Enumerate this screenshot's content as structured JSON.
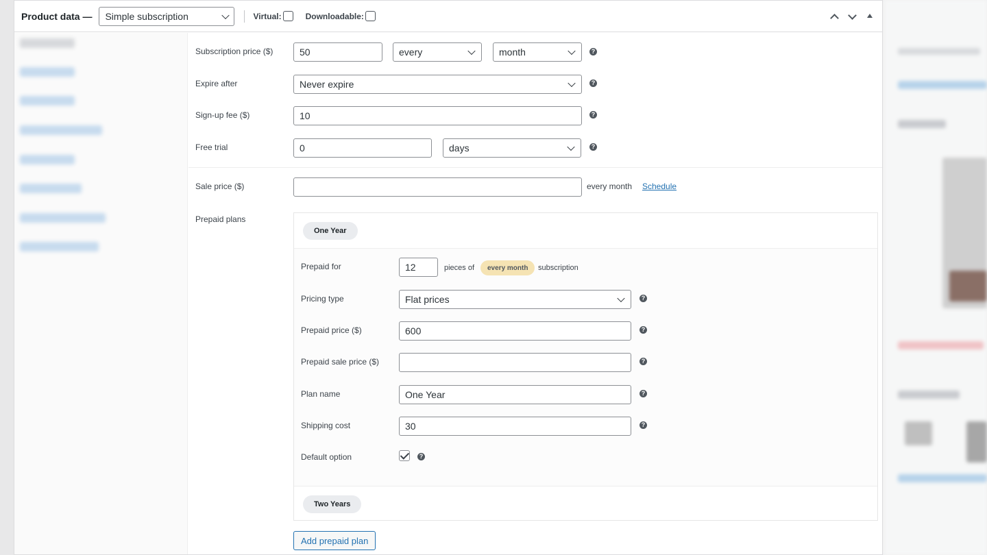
{
  "header": {
    "title": "Product data —",
    "product_type": "Simple subscription",
    "virtual_label": "Virtual:",
    "downloadable_label": "Downloadable:"
  },
  "subscription": {
    "price_label": "Subscription price ($)",
    "price_value": "50",
    "interval_value": "every",
    "period_value": "month",
    "expire_label": "Expire after",
    "expire_value": "Never expire",
    "signup_label": "Sign-up fee ($)",
    "signup_value": "10",
    "trial_label": "Free trial",
    "trial_value": "0",
    "trial_period": "days",
    "sale_label": "Sale price ($)",
    "sale_value": "",
    "sale_suffix": "every month",
    "schedule_link": "Schedule"
  },
  "prepaid": {
    "label": "Prepaid plans",
    "plans": [
      {
        "name_tab": "One Year",
        "prepaid_for_label": "Prepaid for",
        "prepaid_for_value": "12",
        "pieces_of": "pieces of",
        "period_tag": "every month",
        "subscription_word": "subscription",
        "pricing_type_label": "Pricing type",
        "pricing_type_value": "Flat prices",
        "prepaid_price_label": "Prepaid price ($)",
        "prepaid_price_value": "600",
        "prepaid_sale_label": "Prepaid sale price ($)",
        "prepaid_sale_value": "",
        "plan_name_label": "Plan name",
        "plan_name_value": "One Year",
        "shipping_label": "Shipping cost",
        "shipping_value": "30",
        "default_label": "Default option",
        "default_checked": true
      },
      {
        "name_tab": "Two Years"
      }
    ],
    "add_button": "Add prepaid plan"
  },
  "help_glyph": "?",
  "colors": {
    "accent": "#2271b1",
    "tag_bg": "#f5e3b3",
    "pill_bg": "#eaecef"
  }
}
